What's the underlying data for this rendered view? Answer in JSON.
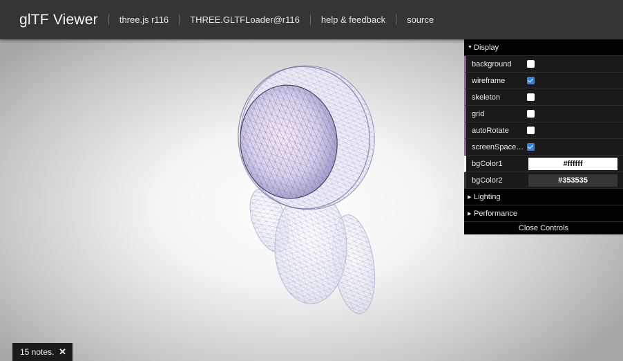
{
  "header": {
    "title": "glTF Viewer",
    "links": [
      "three.js r116",
      "THREE.GLTFLoader@r116",
      "help & feedback",
      "source"
    ]
  },
  "controls": {
    "display_folder": "Display",
    "rows": [
      {
        "label": "background",
        "checked": false
      },
      {
        "label": "wireframe",
        "checked": true
      },
      {
        "label": "skeleton",
        "checked": false
      },
      {
        "label": "grid",
        "checked": false
      },
      {
        "label": "autoRotate",
        "checked": false
      },
      {
        "label": "screenSpacePanning",
        "checked": true
      }
    ],
    "bgColor1": {
      "label": "bgColor1",
      "value": "#ffffff"
    },
    "bgColor2": {
      "label": "bgColor2",
      "value": "#353535"
    },
    "lighting_folder": "Lighting",
    "performance_folder": "Performance",
    "close_label": "Close Controls"
  },
  "notes": {
    "text": "15 notes.",
    "close_icon": "close-icon"
  },
  "colors": {
    "header": "#353535",
    "accent": "#806787",
    "checkbox": "#2f80ed"
  }
}
